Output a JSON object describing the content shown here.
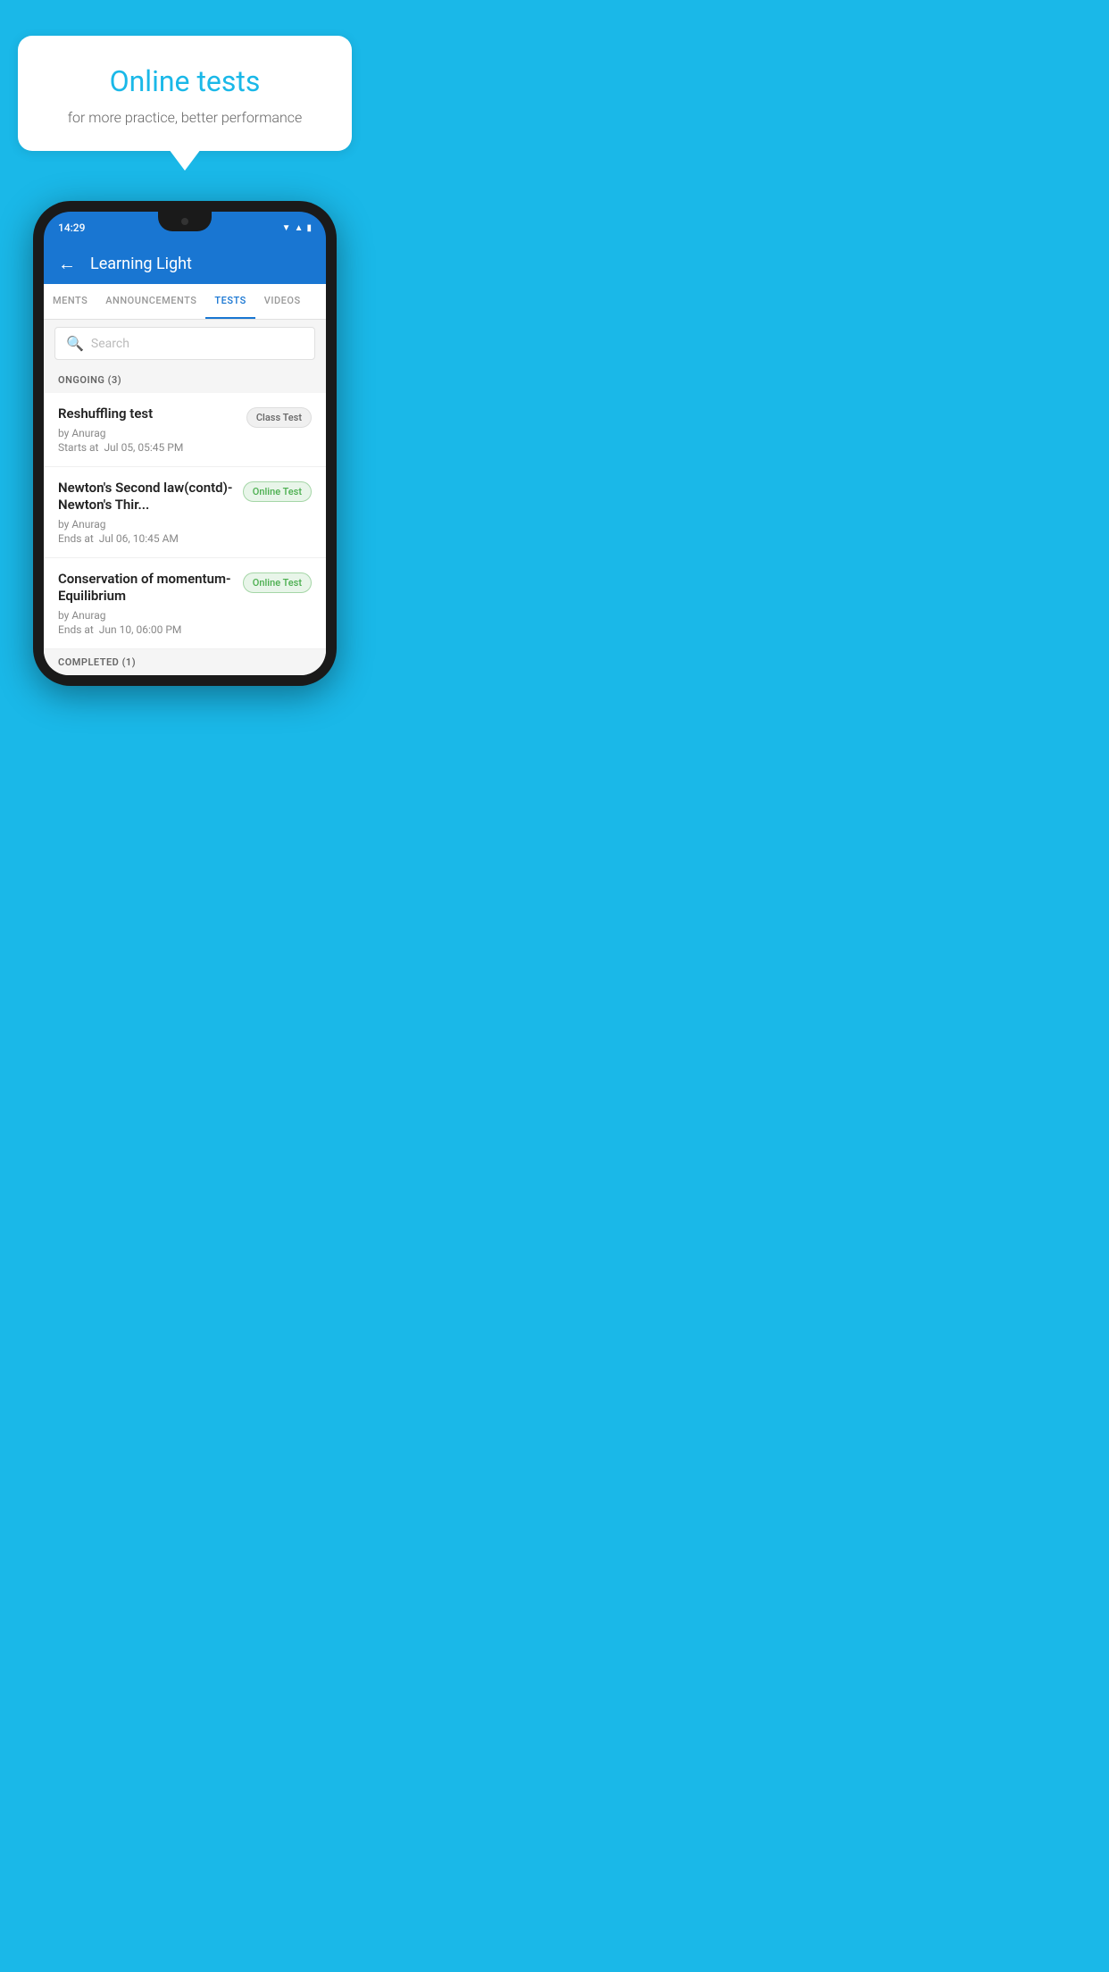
{
  "background_color": "#1ab8e8",
  "speech_bubble": {
    "title": "Online tests",
    "subtitle": "for more practice, better performance"
  },
  "phone": {
    "status_bar": {
      "time": "14:29",
      "icons": [
        "wifi",
        "signal",
        "battery"
      ]
    },
    "header": {
      "title": "Learning Light",
      "back_label": "←"
    },
    "tabs": [
      {
        "label": "MENTS",
        "active": false
      },
      {
        "label": "ANNOUNCEMENTS",
        "active": false
      },
      {
        "label": "TESTS",
        "active": true
      },
      {
        "label": "VIDEOS",
        "active": false
      }
    ],
    "search": {
      "placeholder": "Search"
    },
    "ongoing_section": {
      "label": "ONGOING (3)"
    },
    "test_items": [
      {
        "name": "Reshuffling test",
        "author": "by Anurag",
        "date": "Starts at  Jul 05, 05:45 PM",
        "badge": "Class Test",
        "badge_type": "class"
      },
      {
        "name": "Newton's Second law(contd)-Newton's Thir...",
        "author": "by Anurag",
        "date": "Ends at  Jul 06, 10:45 AM",
        "badge": "Online Test",
        "badge_type": "online"
      },
      {
        "name": "Conservation of momentum-Equilibrium",
        "author": "by Anurag",
        "date": "Ends at  Jun 10, 06:00 PM",
        "badge": "Online Test",
        "badge_type": "online"
      }
    ],
    "completed_section": {
      "label": "COMPLETED (1)"
    }
  }
}
